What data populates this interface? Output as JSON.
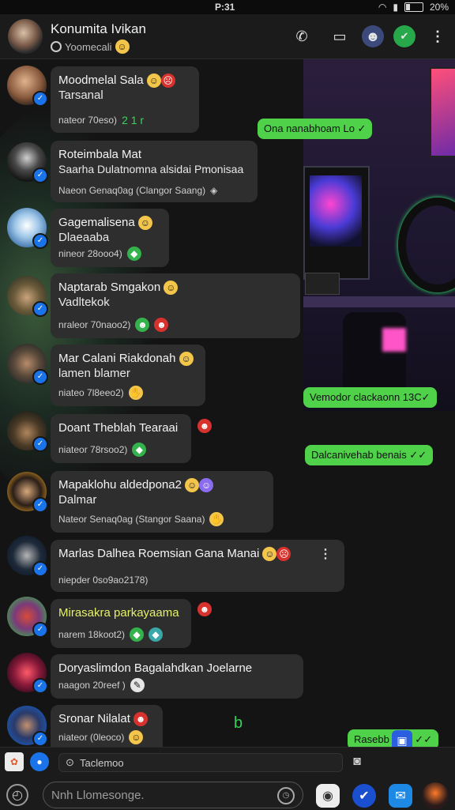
{
  "status_bar": {
    "time": "P:31",
    "battery": "20%"
  },
  "header": {
    "title": "Konumita Ivikan",
    "subtitle": "Yoomecali",
    "subtitle_icon": "smile-emoji"
  },
  "outgoing": [
    {
      "text": "Ona nanabhoam Lo ✓"
    },
    {
      "text": "Vemodor clackaonn 13C✓"
    },
    {
      "text": "Dalcanivehab benais ✓✓"
    },
    {
      "text": "Rasebb ... m ✓✓"
    }
  ],
  "messages": [
    {
      "name": "Moodmelal Sala",
      "text": "Tarsanal",
      "meta": "nateor 70eso)",
      "extra": "2 1 r"
    },
    {
      "name": "Roteimbala Mat",
      "text": "Saarha Dulatnomna alsidai Pmonisaa",
      "meta": "Naeon Genaq0ag (Clangor Saang)"
    },
    {
      "name": "Gagemalisena",
      "text": "Dlaeaaba",
      "meta": "nineor 28ooo4)"
    },
    {
      "name": "Naptarab Smgakon",
      "text": "Vadltekok",
      "meta": "nraleor 70naoo2)"
    },
    {
      "name": "Mar Calani Riakdonah",
      "text": "lamen blamer",
      "meta": "niateo 7l8eeo2)"
    },
    {
      "name": "Doant Theblah Tearaai",
      "text": "",
      "meta": "niateor 78rsoo2)"
    },
    {
      "name": "Mapaklohu aldedpona2",
      "text": "Dalmar",
      "meta": "Nateor Senaq0ag (Stangor Saana)"
    },
    {
      "name": "Marlas Dalhea Roemsian Gana Manai",
      "text": "",
      "meta": "niepder 0so9ao2178)"
    },
    {
      "name": "Mirasakra parkayaama",
      "text": "",
      "meta": "narem 18koot2)"
    },
    {
      "name": "Doryaslimdon Bagalahdkan Joelarne",
      "text": "",
      "meta": "naagon 20reef )"
    },
    {
      "name": "Sronar Nilalat",
      "text": "",
      "meta": "niateor (0leoco)"
    }
  ],
  "input": {
    "search_placeholder": "Taclemoo",
    "message_placeholder": "Nnh Llomesonge."
  },
  "colors": {
    "outgoing_bubble": "#4fd24a",
    "incoming_bubble": "#2e2e2e",
    "badge": "#1a73e8"
  }
}
